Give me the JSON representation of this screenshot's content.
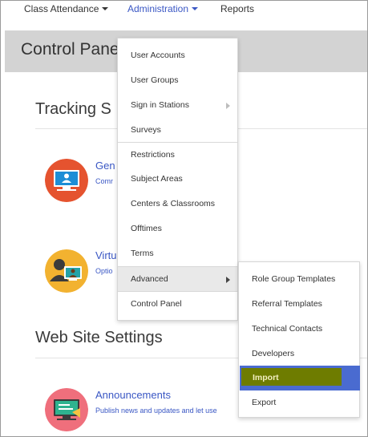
{
  "nav": {
    "items": [
      {
        "label": "Class Attendance"
      },
      {
        "label": "Administration"
      },
      {
        "label": "Reports"
      }
    ]
  },
  "header": {
    "title": "Control Panel"
  },
  "sections": [
    {
      "title": "Tracking S",
      "items": [
        {
          "title": "Gen",
          "desc": "Comr",
          "icon": "monitor-user-icon"
        },
        {
          "title": "Virtu",
          "desc": "Optio",
          "icon": "video-call-icon"
        }
      ]
    },
    {
      "title": "Web Site Settings",
      "items": [
        {
          "title": "Announcements",
          "desc": "Publish news and updates and let use",
          "icon": "announcement-monitor-icon"
        }
      ]
    }
  ],
  "admin_menu": {
    "items": [
      {
        "label": "User Accounts"
      },
      {
        "label": "User Groups"
      },
      {
        "label": "Sign in Stations"
      },
      {
        "label": "Surveys"
      },
      {
        "label": "Restrictions"
      },
      {
        "label": "Subject Areas"
      },
      {
        "label": "Centers & Classrooms"
      },
      {
        "label": "Offtimes"
      },
      {
        "label": "Terms"
      },
      {
        "label": "Advanced"
      },
      {
        "label": "Control Panel"
      }
    ]
  },
  "advanced_menu": {
    "items": [
      {
        "label": "Role Group Templates"
      },
      {
        "label": "Referral Templates"
      },
      {
        "label": "Technical Contacts"
      },
      {
        "label": "Developers"
      },
      {
        "label": "Import"
      },
      {
        "label": "Export"
      }
    ]
  },
  "colors": {
    "link": "#3a57c4",
    "header_bar": "#d3d3d3",
    "import_highlight": "#6e7c00",
    "menu_selected": "#4a6bd0"
  }
}
